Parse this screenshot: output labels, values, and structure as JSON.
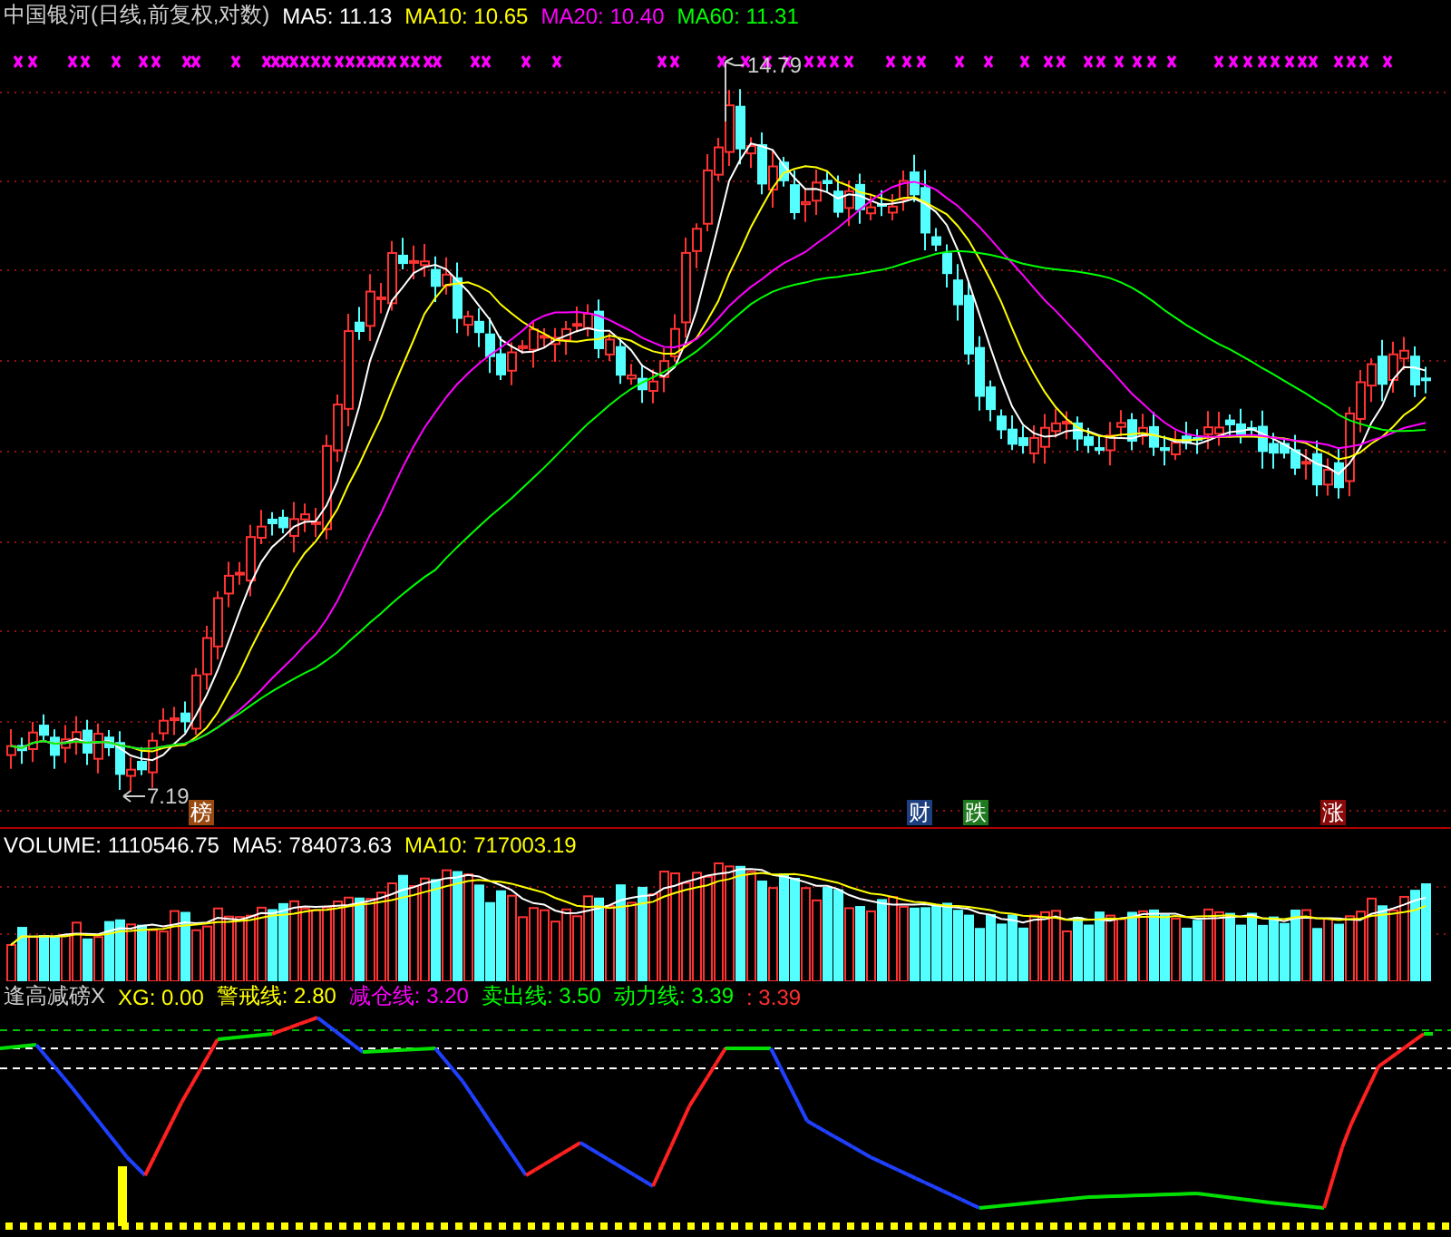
{
  "title": "中国银河(日线,前复权,对数)",
  "ma_legend": [
    {
      "label": "MA5:",
      "value": "11.13",
      "color": "#ffffff"
    },
    {
      "label": "MA10:",
      "value": "10.65",
      "color": "#ffff00"
    },
    {
      "label": "MA20:",
      "value": "10.40",
      "color": "#ff00ff"
    },
    {
      "label": "MA60:",
      "value": "11.31",
      "color": "#00ff00"
    }
  ],
  "price_labels": {
    "high": "14.79",
    "low": "7.19"
  },
  "event_tags": [
    {
      "text": "榜",
      "color": "#9a4a10"
    },
    {
      "text": "财",
      "color": "#1c3f80"
    },
    {
      "text": "跌",
      "color": "#1f7a1f"
    },
    {
      "text": "涨",
      "color": "#8a0a0a"
    }
  ],
  "volume_legend": [
    {
      "label": "VOLUME:",
      "value": "1110546.75",
      "color": "#ffffff"
    },
    {
      "label": "MA5:",
      "value": "784073.63",
      "color": "#ffffff"
    },
    {
      "label": "MA10:",
      "value": "717003.19",
      "color": "#ffff00"
    }
  ],
  "indicator_name": "逢高减磅X",
  "indicator_legend": [
    {
      "label": "XG:",
      "value": "0.00",
      "color": "#ffff00"
    },
    {
      "label": "警戒线:",
      "value": "2.80",
      "color": "#ffff00"
    },
    {
      "label": "减仓线:",
      "value": "3.20",
      "color": "#ff00ff"
    },
    {
      "label": "卖出线:",
      "value": "3.50",
      "color": "#00ff00"
    },
    {
      "label": "动力线:",
      "value": "3.39",
      "color": "#00ff00"
    },
    {
      "label": ":",
      "value": "3.39",
      "color": "#ff3030"
    }
  ]
}
